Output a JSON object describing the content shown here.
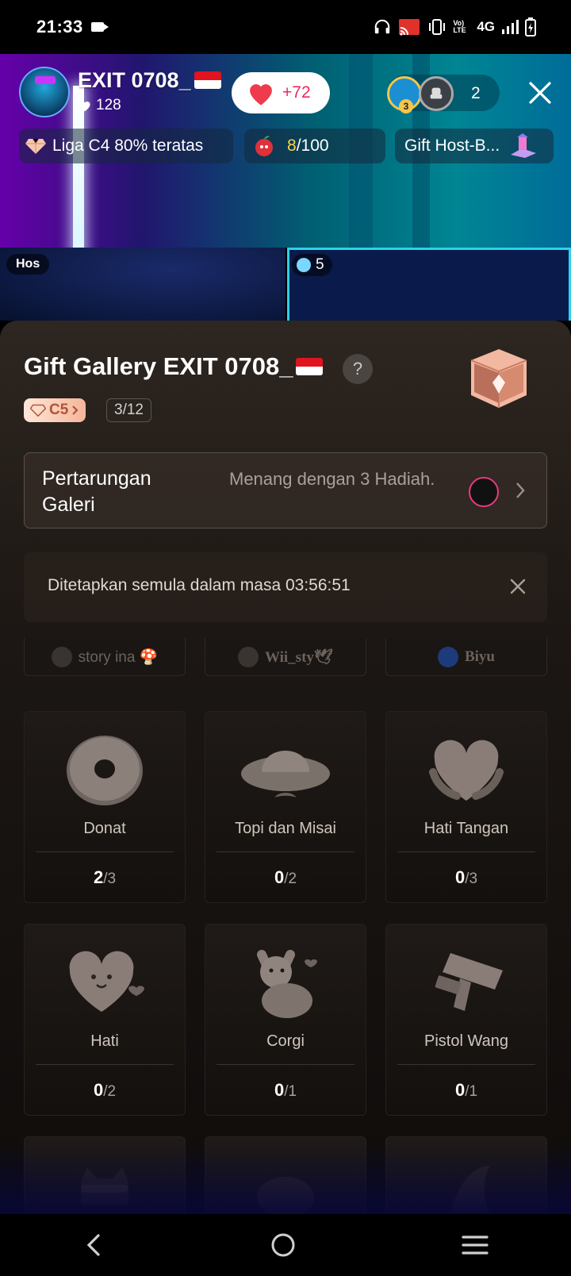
{
  "status_bar": {
    "time": "21:33",
    "net_volte": "Vo) LTE",
    "net_type": "4G"
  },
  "live": {
    "host_name": "EXIT 0708_",
    "host_likes": "128",
    "like_delta": "+72",
    "viewer_count": "2",
    "viewer_rank": "3",
    "league_text": "Liga C4 80% teratas",
    "goal_current": "8",
    "goal_total": "/100",
    "gift_host_text": "Gift Host-B...",
    "guest_host_tag": "Hos",
    "guest_score": "5"
  },
  "sheet": {
    "title": "Gift Gallery EXIT 0708_",
    "help_label": "?",
    "rank_label": "C5",
    "progress": "3/12",
    "battle_title": "Pertarungan Galeri",
    "battle_desc": "Menang dengan 3 Hadiah.",
    "reset_text": "Ditetapkan semula dalam masa 03:56:51",
    "top_gifters": [
      "story ina 🍄",
      "Wii_sty🕊",
      "Biyu"
    ],
    "gifts": [
      {
        "name": "Donat",
        "count": "2",
        "total": "/3",
        "icon": "donut-icon"
      },
      {
        "name": "Topi dan Misai",
        "count": "0",
        "total": "/2",
        "icon": "hat-mustache-icon"
      },
      {
        "name": "Hati Tangan",
        "count": "0",
        "total": "/3",
        "icon": "heart-hands-icon"
      },
      {
        "name": "Hati",
        "count": "0",
        "total": "/2",
        "icon": "heart-icon"
      },
      {
        "name": "Corgi",
        "count": "0",
        "total": "/1",
        "icon": "corgi-icon"
      },
      {
        "name": "Pistol Wang",
        "count": "0",
        "total": "/1",
        "icon": "money-gun-icon"
      }
    ]
  },
  "colors": {
    "accent_pink": "#ec2a5c",
    "goal_yellow": "#f6d34a",
    "rank_text": "#b2533a"
  }
}
